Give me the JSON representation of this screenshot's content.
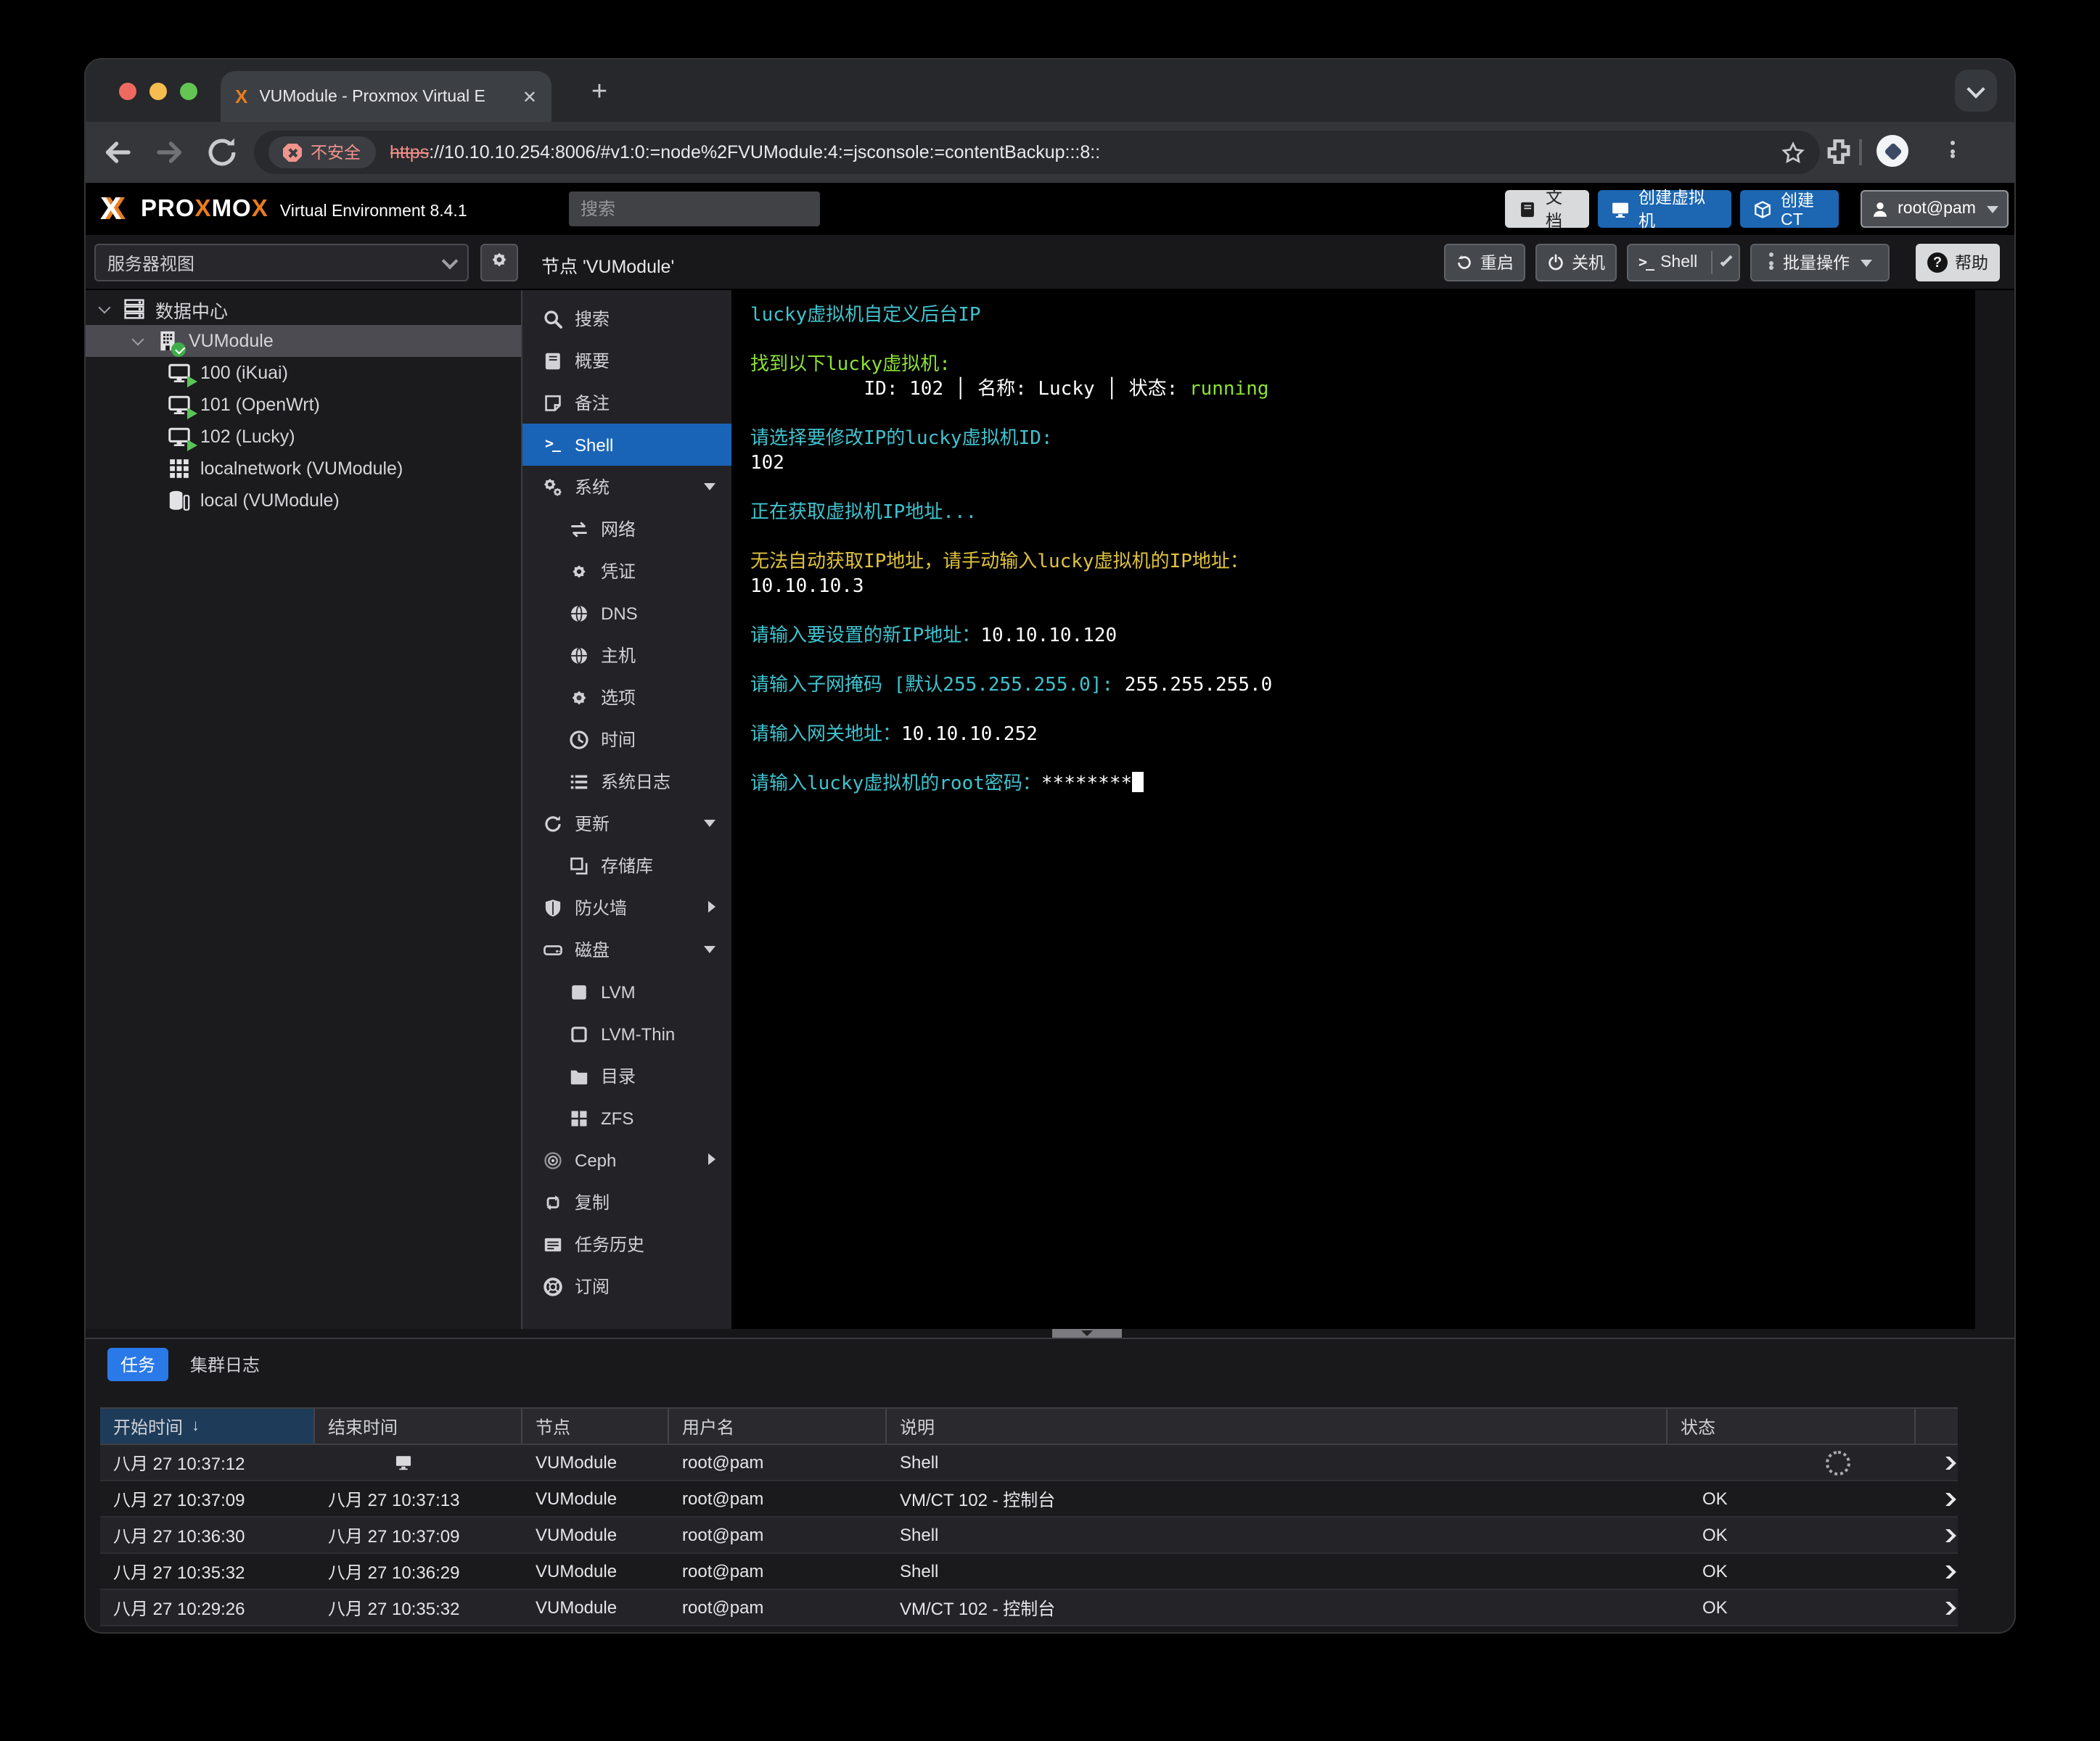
{
  "colors": {
    "accent_blue": "#1c66b2",
    "selected_menu": "#1a64b8",
    "tab_blue": "#2a79e8",
    "console_cyan": "#3fc3cf",
    "console_green": "#8ce234",
    "console_yellow": "#dfc23d",
    "proxmox_orange": "#e87d1e",
    "insecure_pink": "#f1948c"
  },
  "browser": {
    "tab_title": "VUModule - Proxmox Virtual E",
    "security_label": "不安全",
    "url_scheme": "https",
    "url_rest": "://10.10.10.254:8006/#v1:0:=node%2FVUModule:4:=jsconsole:=contentBackup:::8::"
  },
  "header": {
    "logo_mark": "X",
    "logo_parts": [
      "PRO",
      "X",
      "MO",
      "X"
    ],
    "version": "Virtual Environment 8.4.1",
    "search_placeholder": "搜索",
    "buttons": {
      "docs": "文档",
      "create_vm": "创建虚拟机",
      "create_ct": "创建 CT",
      "user": "root@pam"
    }
  },
  "sidebar": {
    "view_label": "服务器视图",
    "tree": [
      {
        "id": "datacenter",
        "label": "数据中心",
        "icon": "datacenter",
        "level": 0,
        "caret": true
      },
      {
        "id": "vumodule",
        "label": "VUModule",
        "icon": "building",
        "level": 1,
        "caret": true,
        "selected": true,
        "badge": true
      },
      {
        "id": "vm-100",
        "label": "100 (iKuai)",
        "icon": "vm",
        "level": 2,
        "play": true
      },
      {
        "id": "vm-101",
        "label": "101 (OpenWrt)",
        "icon": "vm",
        "level": 2,
        "play": true
      },
      {
        "id": "vm-102",
        "label": "102 (Lucky)",
        "icon": "vm",
        "level": 2,
        "play": true
      },
      {
        "id": "localnetwork",
        "label": "localnetwork (VUModule)",
        "icon": "grid",
        "level": 2
      },
      {
        "id": "local-storage",
        "label": "local (VUModule)",
        "icon": "storage",
        "level": 2
      }
    ]
  },
  "node": {
    "title": "节点 'VUModule'",
    "actions": {
      "reboot": "重启",
      "shutdown": "关机",
      "shell": "Shell",
      "bulk": "批量操作",
      "help": "帮助"
    },
    "menu": [
      {
        "id": "search",
        "label": "搜索",
        "icon": "search"
      },
      {
        "id": "summary",
        "label": "概要",
        "icon": "book"
      },
      {
        "id": "notes",
        "label": "备注",
        "icon": "note"
      },
      {
        "id": "shell",
        "label": "Shell",
        "icon": "terminal",
        "selected": true
      },
      {
        "id": "system",
        "label": "系统",
        "icon": "gears",
        "caret": "down"
      },
      {
        "id": "network",
        "label": "网络",
        "icon": "exchange",
        "indent": true
      },
      {
        "id": "certificates",
        "label": "凭证",
        "icon": "cert",
        "indent": true
      },
      {
        "id": "dns",
        "label": "DNS",
        "icon": "globe",
        "indent": true
      },
      {
        "id": "hosts",
        "label": "主机",
        "icon": "globe",
        "indent": true
      },
      {
        "id": "options",
        "label": "选项",
        "icon": "gear",
        "indent": true
      },
      {
        "id": "time",
        "label": "时间",
        "icon": "clock",
        "indent": true
      },
      {
        "id": "syslog",
        "label": "系统日志",
        "icon": "list",
        "indent": true
      },
      {
        "id": "updates",
        "label": "更新",
        "icon": "refresh",
        "caret": "down"
      },
      {
        "id": "repositories",
        "label": "存储库",
        "icon": "copy",
        "indent": true
      },
      {
        "id": "firewall",
        "label": "防火墙",
        "icon": "shield",
        "caret": "right"
      },
      {
        "id": "disks",
        "label": "磁盘",
        "icon": "hdd",
        "caret": "down"
      },
      {
        "id": "lvm",
        "label": "LVM",
        "icon": "square",
        "indent": true
      },
      {
        "id": "lvm-thin",
        "label": "LVM-Thin",
        "icon": "square-o",
        "indent": true
      },
      {
        "id": "directory",
        "label": "目录",
        "icon": "folder",
        "indent": true
      },
      {
        "id": "zfs",
        "label": "ZFS",
        "icon": "th",
        "indent": true
      },
      {
        "id": "ceph",
        "label": "Ceph",
        "icon": "ceph",
        "caret": "right"
      },
      {
        "id": "replication",
        "label": "复制",
        "icon": "retweet"
      },
      {
        "id": "task-history",
        "label": "任务历史",
        "icon": "tasks"
      },
      {
        "id": "subscription",
        "label": "订阅",
        "icon": "support"
      }
    ]
  },
  "console": {
    "lines": [
      [
        {
          "c": "cyan",
          "t": "lucky虚拟机自定义后台IP"
        }
      ],
      [],
      [
        {
          "c": "green",
          "t": "找到以下lucky虚拟机:"
        }
      ],
      [
        {
          "c": "white",
          "t": "          ID: 102 │ 名称: Lucky │ 状态: "
        },
        {
          "c": "green",
          "t": "running"
        }
      ],
      [],
      [
        {
          "c": "cyan",
          "t": "请选择要修改IP的lucky虚拟机ID:"
        }
      ],
      [
        {
          "c": "white",
          "t": "102"
        }
      ],
      [],
      [
        {
          "c": "cyan",
          "t": "正在获取虚拟机IP地址..."
        }
      ],
      [],
      [
        {
          "c": "yellow",
          "t": "无法自动获取IP地址，请手动输入lucky虚拟机的IP地址："
        }
      ],
      [
        {
          "c": "white",
          "t": "10.10.10.3"
        }
      ],
      [],
      [
        {
          "c": "cyan",
          "t": "请输入要设置的新IP地址："
        },
        {
          "c": "white",
          "t": "10.10.10.120"
        }
      ],
      [],
      [
        {
          "c": "cyan",
          "t": "请输入子网掩码 [默认255.255.255.0]: "
        },
        {
          "c": "white",
          "t": "255.255.255.0"
        }
      ],
      [],
      [
        {
          "c": "cyan",
          "t": "请输入网关地址："
        },
        {
          "c": "white",
          "t": "10.10.10.252"
        }
      ],
      [],
      [
        {
          "c": "cyan",
          "t": "请输入lucky虚拟机的root密码："
        },
        {
          "c": "white",
          "t": "********"
        },
        {
          "c": "cursor",
          "t": ""
        }
      ]
    ]
  },
  "tasks": {
    "tabs": [
      {
        "label": "任务",
        "selected": true
      },
      {
        "label": "集群日志",
        "selected": false
      }
    ],
    "columns": [
      "开始时间",
      "结束时间",
      "节点",
      "用户名",
      "说明",
      "状态"
    ],
    "rows": [
      {
        "start": "八月 27 10:37:12",
        "end": "",
        "end_icon": "monitor",
        "node": "VUModule",
        "user": "root@pam",
        "desc": "Shell",
        "status": "",
        "spinner": true
      },
      {
        "start": "八月 27 10:37:09",
        "end": "八月 27 10:37:13",
        "node": "VUModule",
        "user": "root@pam",
        "desc": "VM/CT 102 - 控制台",
        "status": "OK"
      },
      {
        "start": "八月 27 10:36:30",
        "end": "八月 27 10:37:09",
        "node": "VUModule",
        "user": "root@pam",
        "desc": "Shell",
        "status": "OK"
      },
      {
        "start": "八月 27 10:35:32",
        "end": "八月 27 10:36:29",
        "node": "VUModule",
        "user": "root@pam",
        "desc": "Shell",
        "status": "OK"
      },
      {
        "start": "八月 27 10:29:26",
        "end": "八月 27 10:35:32",
        "node": "VUModule",
        "user": "root@pam",
        "desc": "VM/CT 102 - 控制台",
        "status": "OK"
      }
    ]
  }
}
